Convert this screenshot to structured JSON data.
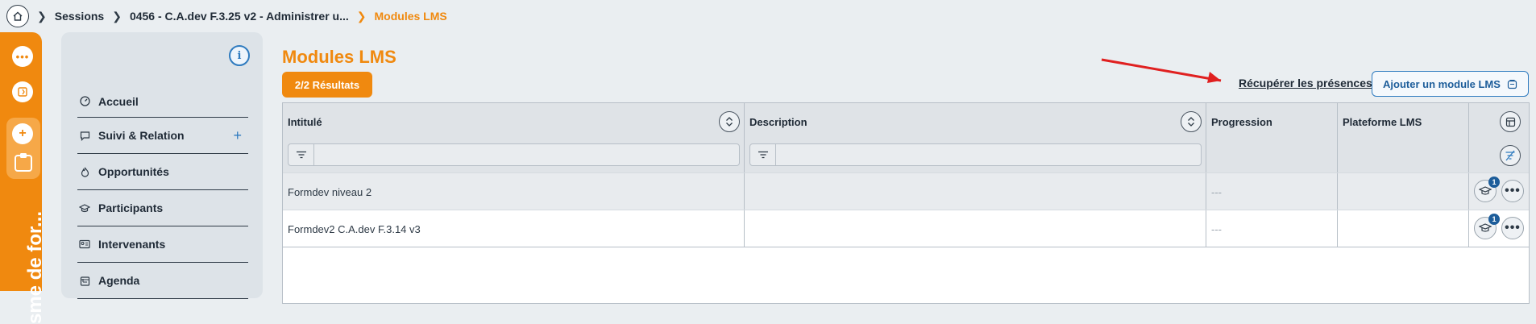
{
  "breadcrumb": {
    "items": [
      "Sessions",
      "0456 - C.A.dev F.3.25 v2 - Administrer u..."
    ],
    "current": "Modules LMS"
  },
  "rail": {
    "vertical_text": "sme de for..."
  },
  "nav": {
    "items": [
      {
        "label": "Accueil",
        "icon": "dashboard-icon"
      },
      {
        "label": "Suivi & Relation",
        "icon": "chat-icon"
      },
      {
        "label": "Opportunités",
        "icon": "flame-icon"
      },
      {
        "label": "Participants",
        "icon": "graduation-cap-icon"
      },
      {
        "label": "Intervenants",
        "icon": "id-card-icon"
      },
      {
        "label": "Agenda",
        "icon": "calendar-icon"
      }
    ]
  },
  "main": {
    "title": "Modules LMS",
    "results": "2/2 Résultats",
    "recup_link": "Récupérer les présences",
    "add_button": "Ajouter un module LMS"
  },
  "table": {
    "columns": [
      "Intitulé",
      "Description",
      "Progression",
      "Plateforme LMS"
    ],
    "rows": [
      {
        "intitule": "Formdev niveau 2",
        "description": "",
        "progression": "---",
        "plateforme": "",
        "badge": "1"
      },
      {
        "intitule": "Formdev2 C.A.dev F.3.14 v3",
        "description": "",
        "progression": "---",
        "plateforme": "",
        "badge": "1"
      }
    ]
  },
  "colors": {
    "accent": "#f0890f",
    "link_blue": "#1d5d9a",
    "arrow_red": "#e02020"
  }
}
